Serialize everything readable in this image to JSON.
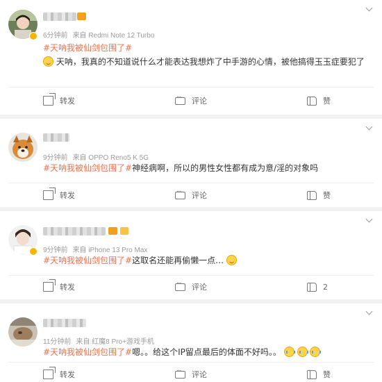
{
  "colors": {
    "topic": "#eb7350",
    "meta": "#9a9a9a",
    "background": "#f2f2f2"
  },
  "posts": [
    {
      "time": "6分钟前",
      "source": "来自 Redmi Note 12 Turbo",
      "topic": "#天呐我被仙剑包围了#",
      "text": "天呐，我真的不知道说什么才能表达我想炸了中手游的心情，被他搞得玉玉症要犯了",
      "actions": {
        "repost": "转发",
        "comment": "评论",
        "like": "赞"
      }
    },
    {
      "time": "9分钟前",
      "source": "来自 OPPO Reno5 K 5G",
      "topic": "#天呐我被仙剑包围了#",
      "text": "神经病啊，所以的男性女性都有成为意/淫的对象吗",
      "actions": {
        "repost": "转发",
        "comment": "评论",
        "like": "赞"
      }
    },
    {
      "time": "9分钟前",
      "source": "来自 iPhone 13 Pro Max",
      "topic": "#天呐我被仙剑包围了#",
      "text": "这取名还能再偷懒一点…",
      "actions": {
        "repost": "转发",
        "comment": "评论",
        "like": "2"
      }
    },
    {
      "time": "11分钟前",
      "source": "来自 红魔8 Pro+游戏手机",
      "topic": "#天呐我被仙剑包围了#",
      "text": "嗯。。给这个IP留点最后的体面不好吗。。",
      "actions": {
        "repost": "转发",
        "comment": "评论",
        "like": "赞"
      }
    }
  ]
}
